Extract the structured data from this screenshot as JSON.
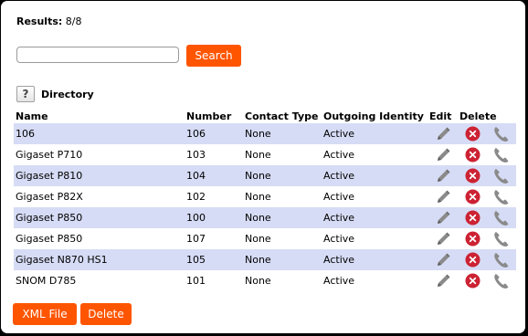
{
  "results": {
    "label": "Results:",
    "value": "8/8"
  },
  "search": {
    "value": "",
    "placeholder": "",
    "button_label": "Search"
  },
  "directory": {
    "help_glyph": "?",
    "title": "Directory"
  },
  "table": {
    "headers": {
      "name": "Name",
      "number": "Number",
      "contact_type": "Contact Type",
      "outgoing_identity": "Outgoing Identity",
      "edit": "Edit",
      "delete": "Delete"
    },
    "rows": [
      {
        "name": "106",
        "number": "106",
        "contact_type": "None",
        "outgoing_identity": "Active"
      },
      {
        "name": "Gigaset P710",
        "number": "103",
        "contact_type": "None",
        "outgoing_identity": "Active"
      },
      {
        "name": "Gigaset P810",
        "number": "104",
        "contact_type": "None",
        "outgoing_identity": "Active"
      },
      {
        "name": "Gigaset P82X",
        "number": "102",
        "contact_type": "None",
        "outgoing_identity": "Active"
      },
      {
        "name": "Gigaset P850",
        "number": "100",
        "contact_type": "None",
        "outgoing_identity": "Active"
      },
      {
        "name": "Gigaset P850",
        "number": "107",
        "contact_type": "None",
        "outgoing_identity": "Active"
      },
      {
        "name": "Gigaset N870 HS1",
        "number": "105",
        "contact_type": "None",
        "outgoing_identity": "Active"
      },
      {
        "name": "SNOM D785",
        "number": "101",
        "contact_type": "None",
        "outgoing_identity": "Active"
      }
    ]
  },
  "actions": {
    "xml_label": "XML File",
    "delete_label": "Delete"
  },
  "icons": {
    "edit": "pencil-icon",
    "delete": "delete-x-icon",
    "call": "phone-icon"
  },
  "colors": {
    "accent": "#ff5500",
    "row_alt": "#d6dcf5",
    "delete_red": "#cc2233"
  }
}
